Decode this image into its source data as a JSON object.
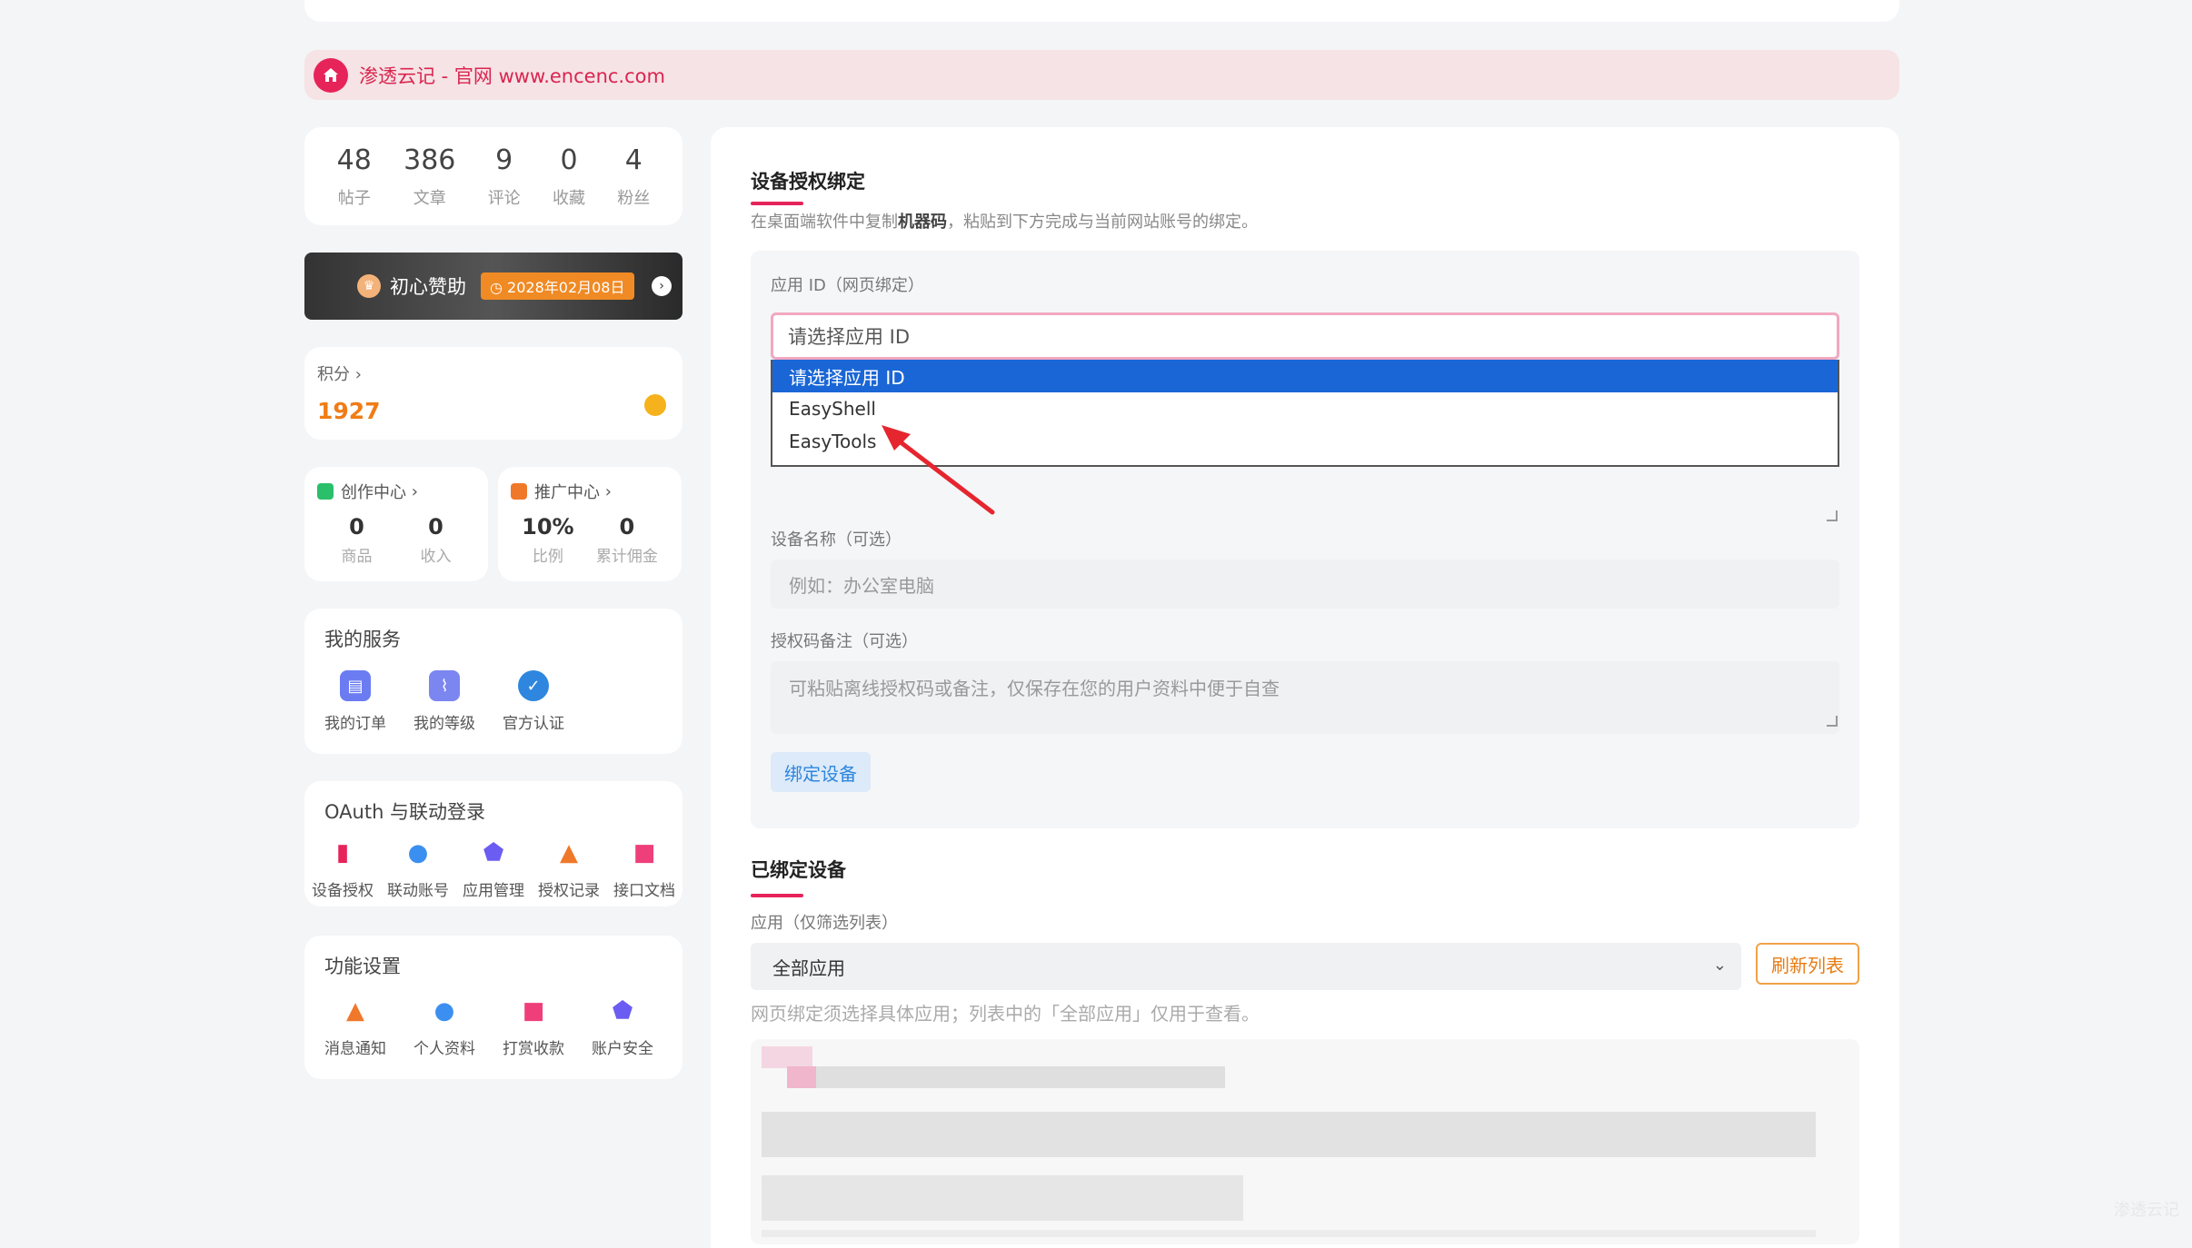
{
  "notice": {
    "text": "渗透云记 - 官网 www.encenc.com"
  },
  "stats": [
    {
      "value": "48",
      "label": "帖子"
    },
    {
      "value": "386",
      "label": "文章"
    },
    {
      "value": "9",
      "label": "评论"
    },
    {
      "value": "0",
      "label": "收藏"
    },
    {
      "value": "4",
      "label": "粉丝"
    }
  ],
  "vip": {
    "title": "初心赞助",
    "date": "2028年02月08日"
  },
  "points": {
    "label": "积分",
    "value": "1927"
  },
  "creator": {
    "title": "创作中心",
    "items": [
      {
        "value": "0",
        "label": "商品"
      },
      {
        "value": "0",
        "label": "收入"
      }
    ]
  },
  "promo": {
    "title": "推广中心",
    "items": [
      {
        "value": "10%",
        "label": "比例"
      },
      {
        "value": "0",
        "label": "累计佣金"
      }
    ]
  },
  "services": {
    "title": "我的服务",
    "items": [
      {
        "label": "我的订单",
        "icon": "order-icon",
        "color": "#6b7cf2"
      },
      {
        "label": "我的等级",
        "icon": "chart-icon",
        "color": "#7b86f0"
      },
      {
        "label": "官方认证",
        "icon": "verified-icon",
        "color": "#2e86de"
      }
    ]
  },
  "oauth": {
    "title": "OAuth 与联动登录",
    "items": [
      {
        "label": "设备授权",
        "icon": "device-icon",
        "color": "#e6245a"
      },
      {
        "label": "联动账号",
        "icon": "user-link-icon",
        "color": "#3b8ff0"
      },
      {
        "label": "应用管理",
        "icon": "shield-icon",
        "color": "#6b5cf2"
      },
      {
        "label": "授权记录",
        "icon": "bell-icon",
        "color": "#f0782a"
      },
      {
        "label": "接口文档",
        "icon": "book-icon",
        "color": "#ef3f7a"
      }
    ]
  },
  "settings": {
    "title": "功能设置",
    "items": [
      {
        "label": "消息通知",
        "icon": "bell-icon",
        "color": "#f0782a"
      },
      {
        "label": "个人资料",
        "icon": "profile-icon",
        "color": "#3b8ff0"
      },
      {
        "label": "打赏收款",
        "icon": "gift-icon",
        "color": "#ef3f7a"
      },
      {
        "label": "账户安全",
        "icon": "shield-icon",
        "color": "#6b5cf2"
      }
    ]
  },
  "bind": {
    "title": "设备授权绑定",
    "subtitle_pre": "在桌面端软件中复制",
    "subtitle_bold": "机器码",
    "subtitle_post": "，粘贴到下方完成与当前网站账号的绑定。",
    "app_label": "应用 ID（网页绑定）",
    "app_selected": "请选择应用 ID",
    "app_options": [
      "请选择应用 ID",
      "EasyShell",
      "EasyTools"
    ],
    "device_label": "设备名称（可选）",
    "device_placeholder": "例如：办公室电脑",
    "note_label": "授权码备注（可选）",
    "note_placeholder": "可粘贴离线授权码或备注，仅保存在您的用户资料中便于自查",
    "button": "绑定设备"
  },
  "bound": {
    "title": "已绑定设备",
    "filter_label": "应用（仅筛选列表）",
    "filter_value": "全部应用",
    "refresh": "刷新列表",
    "hint": "网页绑定须选择具体应用；列表中的「全部应用」仅用于查看。"
  },
  "watermark": "渗透云记"
}
